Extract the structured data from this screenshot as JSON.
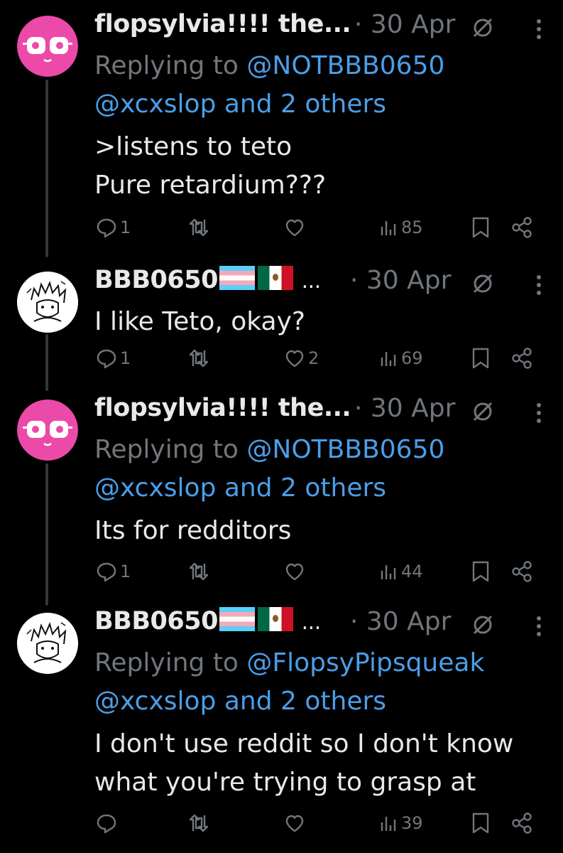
{
  "colors": {
    "background": "#000000",
    "text": "#e7e9ea",
    "muted": "#71767b",
    "link": "#4a9ee8",
    "pink_avatar": "#ec4aa8"
  },
  "tweets": [
    {
      "author": "flopsylvia!!!! the...",
      "date": "· 30 Apr",
      "avatar": "pink-face-avatar",
      "replying_prefix": "Replying to ",
      "replying_handle": "@NOTBBB0650",
      "others": "@xcxslop and 2 others",
      "text": ">listens to teto\nPure retardium???",
      "replies": "1",
      "reposts": "",
      "likes": "",
      "views": "85"
    },
    {
      "author": "BBB0650",
      "author_suffix": "...",
      "flags": [
        "transgender-flag",
        "mexico-flag"
      ],
      "date": "· 30 Apr",
      "avatar": "sketch-character-avatar",
      "text": "I like Teto, okay?",
      "replies": "1",
      "reposts": "",
      "likes": "2",
      "views": "69"
    },
    {
      "author": "flopsylvia!!!! the...",
      "date": "· 30 Apr",
      "avatar": "pink-face-avatar",
      "replying_prefix": "Replying to ",
      "replying_handle": "@NOTBBB0650",
      "others": "@xcxslop and 2 others",
      "text": "Its for redditors",
      "replies": "1",
      "reposts": "",
      "likes": "",
      "views": "44"
    },
    {
      "author": "BBB0650",
      "author_suffix": "...",
      "flags": [
        "transgender-flag",
        "mexico-flag"
      ],
      "date": "· 30 Apr",
      "avatar": "sketch-character-avatar",
      "replying_prefix": "Replying to ",
      "replying_handle": "@FlopsyPipsqueak",
      "others": "@xcxslop and 2 others",
      "text": "I don't use reddit so I don't know\nwhat you're trying to grasp at",
      "replies": "",
      "reposts": "",
      "likes": "",
      "views": "39"
    }
  ]
}
